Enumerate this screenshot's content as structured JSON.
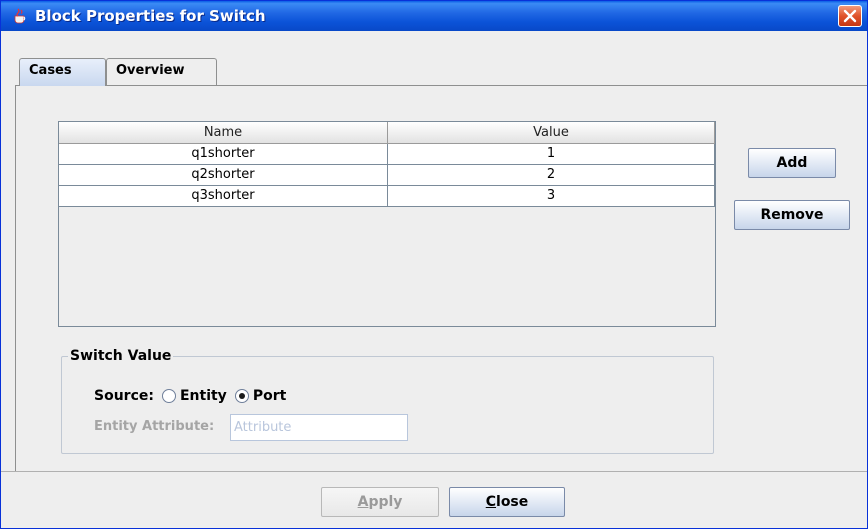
{
  "window": {
    "title": "Block Properties for Switch"
  },
  "tabs": [
    {
      "label": "Cases",
      "selected": true
    },
    {
      "label": "Overview",
      "selected": false
    }
  ],
  "table": {
    "columns": [
      "Name",
      "Value"
    ],
    "rows": [
      {
        "name": "q1shorter",
        "value": "1"
      },
      {
        "name": "q2shorter",
        "value": "2"
      },
      {
        "name": "q3shorter",
        "value": "3"
      }
    ]
  },
  "side_buttons": {
    "add": "Add",
    "remove": "Remove"
  },
  "switch_value": {
    "legend": "Switch Value",
    "source_label": "Source:",
    "options": [
      {
        "label": "Entity",
        "checked": false
      },
      {
        "label": "Port",
        "checked": true
      }
    ],
    "entity_attribute_label": "Entity Attribute:",
    "entity_attribute_placeholder": "Attribute"
  },
  "footer": {
    "apply_mnemonic": "A",
    "apply_rest": "pply",
    "apply_enabled": false,
    "close_mnemonic": "C",
    "close_rest": "lose"
  },
  "colors": {
    "titlebar": "#2067e4",
    "close_button": "#e0522a",
    "disabled_text": "#a5a5a5"
  }
}
